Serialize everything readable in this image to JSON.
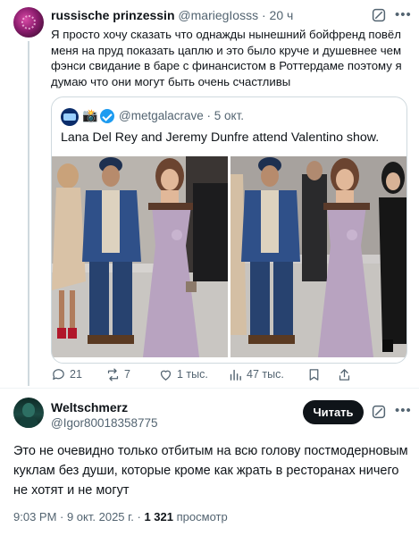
{
  "tweet1": {
    "author_name": "russische prinzessin",
    "author_handle": "@mariegIosss",
    "time": "20 ч",
    "text": "Я просто хочу сказать что однажды нынешний бойфренд повёл меня на пруд показать цаплю и это было круче и душевнее чем фэнси свидание в баре с финансистом в Роттердаме поэтому я думаю что они могут быть очень счастливы",
    "quote": {
      "author_handle": "@metgalacrave",
      "time": "5 окт.",
      "text": "Lana Del Rey and Jeremy Dunfre attend Valentino show."
    },
    "actions": {
      "replies": "21",
      "reposts": "7",
      "likes": "1 тыс.",
      "views": "47 тыс."
    }
  },
  "tweet2": {
    "author_name": "Weltschmerz",
    "author_handle": "@Igor80018358775",
    "follow_label": "Читать",
    "text": "Это не очевидно только отбитым на всю голову постмодерновым куклам без души, которые кроме как жрать в ресторанах ничего не хотят и не могут",
    "timestamp": "9:03 PM · 9 окт. 2025 г. · ",
    "views_count": "1 321",
    "views_label": " просмотр"
  },
  "separator_dot": " · ",
  "colors": {
    "text_primary": "#0f1419",
    "text_secondary": "#536471",
    "border": "#cfd9de",
    "verified": "#1d9bf0",
    "button_dark": "#0f1419"
  },
  "icons": [
    "grok-icon",
    "more-icon",
    "camera-icon",
    "verified-icon",
    "reply-icon",
    "repost-icon",
    "like-icon",
    "views-icon",
    "bookmark-icon",
    "share-icon"
  ]
}
